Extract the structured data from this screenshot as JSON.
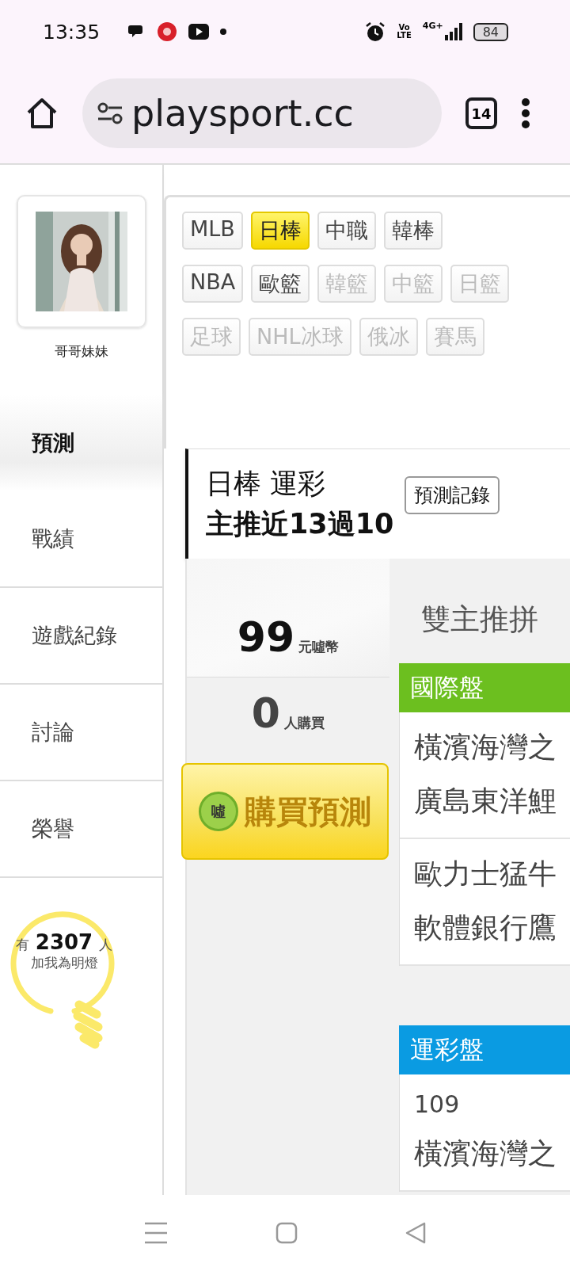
{
  "status_bar": {
    "time": "13:35",
    "volte": [
      "Vo",
      "LTE"
    ],
    "network": "4G+",
    "battery": "84"
  },
  "browser": {
    "url": "playsport.cc",
    "tab_count": "14"
  },
  "profile": {
    "name": "哥哥妹妹"
  },
  "nav": [
    {
      "label": "預測",
      "selected": true
    },
    {
      "label": "戰績",
      "selected": false
    },
    {
      "label": "遊戲紀錄",
      "selected": false
    },
    {
      "label": "討論",
      "selected": false
    },
    {
      "label": "榮譽",
      "selected": false
    }
  ],
  "fans": {
    "prefix": "有",
    "count": "2307",
    "suffix": "人",
    "caption": "加我為明燈"
  },
  "tag_rows": [
    [
      {
        "label": "MLB",
        "selected": false,
        "disabled": false
      },
      {
        "label": "日棒",
        "selected": true,
        "disabled": false
      },
      {
        "label": "中職",
        "selected": false,
        "disabled": false
      },
      {
        "label": "韓棒",
        "selected": false,
        "disabled": false
      }
    ],
    [
      {
        "label": "NBA",
        "selected": false,
        "disabled": false
      },
      {
        "label": "歐籃",
        "selected": false,
        "disabled": false
      },
      {
        "label": "韓籃",
        "selected": false,
        "disabled": true
      },
      {
        "label": "中籃",
        "selected": false,
        "disabled": true
      },
      {
        "label": "日籃",
        "selected": false,
        "disabled": true
      }
    ],
    [
      {
        "label": "足球",
        "selected": false,
        "disabled": true
      },
      {
        "label": "NHL冰球",
        "selected": false,
        "disabled": true
      },
      {
        "label": "俄冰",
        "selected": false,
        "disabled": true
      },
      {
        "label": "賽馬",
        "selected": false,
        "disabled": true
      }
    ]
  ],
  "prediction": {
    "title": "日棒 運彩",
    "record": "主推近13過10",
    "history_button": "預測記錄"
  },
  "price": {
    "amount": "99",
    "unit": "元噓幣"
  },
  "buyers": {
    "count": "0",
    "unit": "人購買"
  },
  "buy_button": {
    "badge": "噓",
    "label": "購買預測"
  },
  "headline": "雙主推拼",
  "markets": [
    {
      "title": "國際盤",
      "color": "#6cbf1f",
      "rows": [
        {
          "lines": [
            "橫濱海灣之",
            "廣島東洋鯉"
          ]
        },
        {
          "lines": [
            "歐力士猛牛",
            "軟體銀行鷹"
          ]
        }
      ]
    },
    {
      "title": "運彩盤",
      "color": "#0a9be2",
      "rows": [
        {
          "lines": [
            "109",
            "橫濱海灣之"
          ]
        }
      ]
    }
  ]
}
